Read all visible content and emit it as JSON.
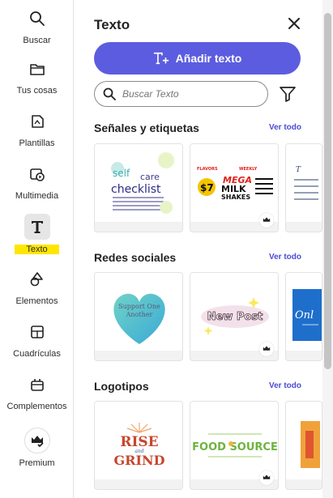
{
  "rail": {
    "items": [
      {
        "label": "Buscar",
        "icon": "search-icon"
      },
      {
        "label": "Tus cosas",
        "icon": "folder-icon"
      },
      {
        "label": "Plantillas",
        "icon": "templates-icon"
      },
      {
        "label": "Multimedia",
        "icon": "media-icon"
      },
      {
        "label": "Texto",
        "icon": "text-icon",
        "active": true
      },
      {
        "label": "Elementos",
        "icon": "shapes-icon"
      },
      {
        "label": "Cuadrículas",
        "icon": "grid-icon"
      },
      {
        "label": "Complementos",
        "icon": "addons-icon"
      },
      {
        "label": "Premium",
        "icon": "crown-icon"
      }
    ]
  },
  "panel": {
    "title": "Texto",
    "add_button": "Añadir texto",
    "search_placeholder": "Buscar Texto"
  },
  "sections": [
    {
      "title": "Señales y etiquetas",
      "link": "Ver todo",
      "cards": [
        {
          "name": "self-care-checklist",
          "texts": [
            "self",
            "care",
            "checklist"
          ],
          "premium": false
        },
        {
          "name": "mega-milk-shakes",
          "texts": [
            "FLAVORS",
            "WEEKLY",
            "MEGA",
            "MILK",
            "SHAKES",
            "$7"
          ],
          "premium": true
        },
        {
          "name": "partial-list-card",
          "texts": [],
          "premium": false
        }
      ]
    },
    {
      "title": "Redes sociales",
      "link": "Ver todo",
      "cards": [
        {
          "name": "support-one-another",
          "texts": [
            "Support One",
            "Another"
          ],
          "premium": false
        },
        {
          "name": "new-post",
          "texts": [
            "New Post"
          ],
          "premium": true
        },
        {
          "name": "partial-online-card",
          "texts": [
            "Onl"
          ],
          "premium": false
        }
      ]
    },
    {
      "title": "Logotipos",
      "link": "Ver todo",
      "cards": [
        {
          "name": "rise-and-grind",
          "texts": [
            "RISE",
            "and",
            "GRIND"
          ],
          "premium": false
        },
        {
          "name": "food-source",
          "texts": [
            "FOOD SOURCE"
          ],
          "premium": true
        },
        {
          "name": "partial-logo-card",
          "texts": [],
          "premium": false
        }
      ]
    }
  ],
  "colors": {
    "accent": "#5c5ce0",
    "link": "#4b4bd6",
    "active_highlight": "#ffe600"
  }
}
